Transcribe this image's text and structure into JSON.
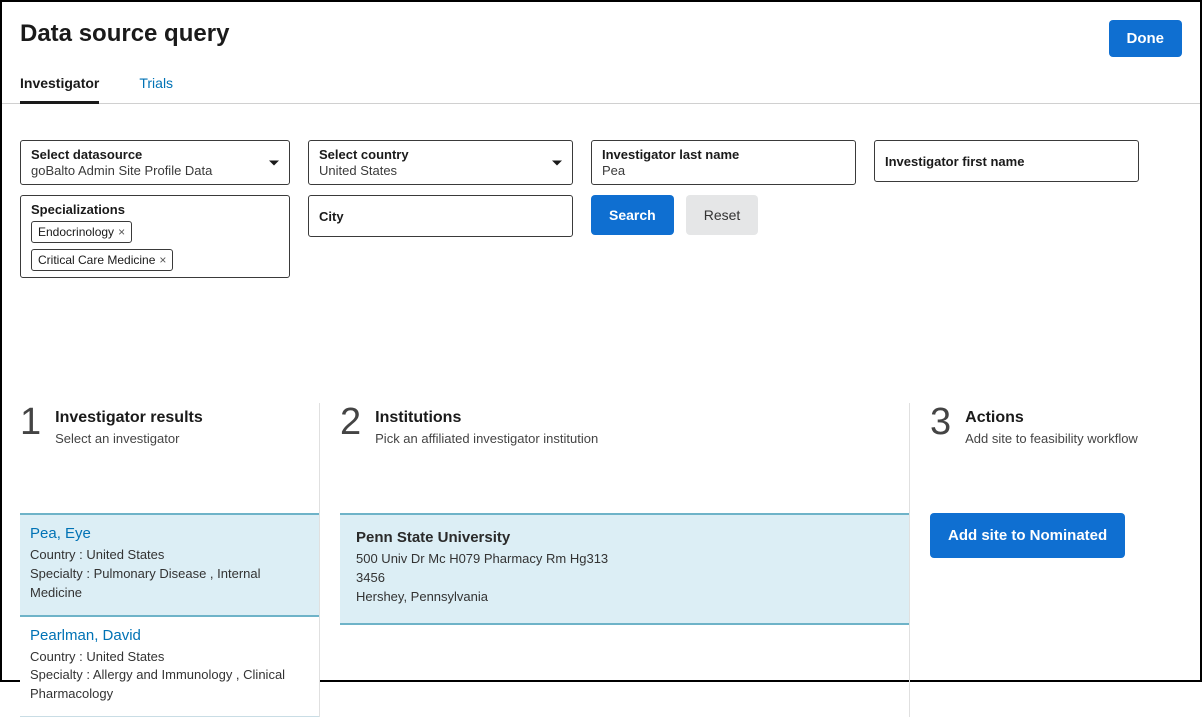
{
  "header": {
    "title": "Data source query",
    "done_label": "Done"
  },
  "tabs": {
    "investigator": "Investigator",
    "trials": "Trials"
  },
  "filters": {
    "datasource": {
      "label": "Select datasource",
      "value": "goBalto Admin Site Profile Data"
    },
    "specializations": {
      "label": "Specializations",
      "chips": [
        "Endocrinology",
        "Critical Care Medicine"
      ]
    },
    "country": {
      "label": "Select country",
      "value": "United States"
    },
    "city": {
      "label": "City"
    },
    "last_name": {
      "label": "Investigator last name",
      "value": "Pea"
    },
    "first_name": {
      "label": "Investigator first name"
    },
    "search_label": "Search",
    "reset_label": "Reset"
  },
  "steps": {
    "s1": {
      "num": "1",
      "title": "Investigator results",
      "sub": "Select an investigator"
    },
    "s2": {
      "num": "2",
      "title": "Institutions",
      "sub": "Pick an affiliated investigator institution"
    },
    "s3": {
      "num": "3",
      "title": "Actions",
      "sub": "Add site to feasibility workflow"
    }
  },
  "investigators": [
    {
      "name": "Pea, Eye",
      "country_label": "Country : United States",
      "specialty_label": "Specialty : Pulmonary Disease , Internal Medicine",
      "selected": true
    },
    {
      "name": "Pearlman, David",
      "country_label": "Country : United States",
      "specialty_label": "Specialty : Allergy and Immunology , Clinical Pharmacology",
      "selected": false
    }
  ],
  "institutions": [
    {
      "name": "Penn State University",
      "line1": "500 Univ Dr Mc H079 Pharmacy Rm Hg313",
      "line2": "3456",
      "line3": "Hershey, Pennsylvania"
    }
  ],
  "actions": {
    "nominate_label": "Add site to Nominated"
  }
}
